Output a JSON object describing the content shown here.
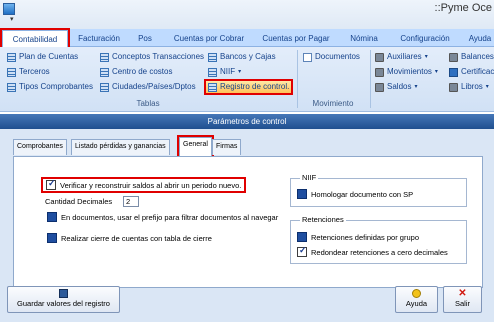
{
  "app": {
    "title": "::Pyme Oce",
    "qat_arrow": "▾"
  },
  "tabs": [
    {
      "label": "Contabilidad"
    },
    {
      "label": "Facturación"
    },
    {
      "label": "Pos"
    },
    {
      "label": "Cuentas por Cobrar"
    },
    {
      "label": "Cuentas por Pagar"
    },
    {
      "label": "Nómina"
    },
    {
      "label": "Configuración"
    },
    {
      "label": "Ayuda"
    }
  ],
  "ribbon": {
    "tablas": {
      "label": "Tablas",
      "col1": [
        "Plan de Cuentas",
        "Terceros",
        "Tipos Comprobantes"
      ],
      "col2": [
        "Conceptos Transacciones",
        "Centro de costos",
        "Ciudades/Países/Dptos"
      ],
      "col3": [
        "Bancos y Cajas",
        "NIIF",
        "Registro de control."
      ]
    },
    "movimiento": {
      "label": "Movimiento",
      "documentos": "Documentos"
    },
    "more": {
      "col1": [
        "Auxiliares",
        "Movimientos",
        "Saldos"
      ],
      "col2": [
        "Balances",
        "Certificac",
        "Libros"
      ]
    }
  },
  "dialog": {
    "title": "Parámetros de control",
    "tabs": [
      "Comprobantes",
      "Listado pérdidas y ganancias",
      "General",
      "Firmas"
    ],
    "general": {
      "verify_label": "Verificar y reconstruir saldos al abrir un periodo nuevo.",
      "cantidad_label": "Cantidad Decimales",
      "cantidad_value": "2",
      "prefijo_label": "En documentos, usar el prefijo para filtrar documentos al navegar",
      "cierre_label": "Realizar cierre de cuentas con tabla de cierre",
      "niif": {
        "title": "NIIF",
        "homologar": "Homologar documento con SP"
      },
      "retenciones": {
        "title": "Retenciones",
        "por_grupo": "Retenciones definidas por grupo",
        "redondear": "Redondear retenciones a cero decimales"
      }
    },
    "buttons": {
      "save": "Guardar valores del registro",
      "help": "Ayuda",
      "exit": "Salir"
    }
  }
}
